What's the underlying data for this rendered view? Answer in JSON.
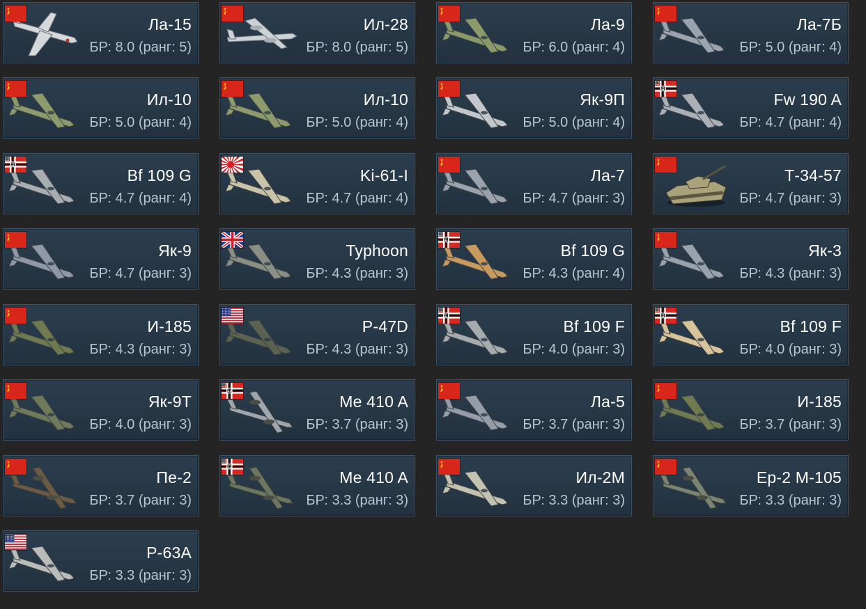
{
  "colors": {
    "background": "#242424",
    "card_bg": "#263746",
    "card_border": "#3c5466",
    "name_text": "#ffffff",
    "br_text": "#b8c6d0"
  },
  "vehicles": [
    {
      "name": "Ла-15",
      "br": "БР: 8.0 (ранг: 5)",
      "flag": "ussr",
      "kind": "jet",
      "camo": "#d6d9dc"
    },
    {
      "name": "Ил-28",
      "br": "БР: 8.0 (ранг: 5)",
      "flag": "ussr",
      "kind": "bomber",
      "camo": "#cdd2d6"
    },
    {
      "name": "Ла-9",
      "br": "БР: 6.0 (ранг: 4)",
      "flag": "ussr",
      "kind": "plane",
      "camo": "#8c9a6a"
    },
    {
      "name": "Ла-7Б",
      "br": "БР: 5.0 (ранг: 4)",
      "flag": "ussr",
      "kind": "plane",
      "camo": "#9aa4ae"
    },
    {
      "name": "Ил-10",
      "br": "БР: 5.0 (ранг: 4)",
      "flag": "ussr",
      "kind": "plane",
      "camo": "#8d9a6b"
    },
    {
      "name": "Ил-10",
      "br": "БР: 5.0 (ранг: 4)",
      "flag": "ussr",
      "kind": "plane",
      "camo": "#8d9a6b"
    },
    {
      "name": "Як-9П",
      "br": "БР: 5.0 (ранг: 4)",
      "flag": "ussr",
      "kind": "plane",
      "camo": "#c3c7cc"
    },
    {
      "name": "Fw 190 A",
      "br": "БР: 4.7 (ранг: 4)",
      "flag": "germany",
      "kind": "plane",
      "camo": "#aab0b6"
    },
    {
      "name": "Bf 109 G",
      "br": "БР: 4.7 (ранг: 4)",
      "flag": "germany",
      "kind": "plane",
      "camo": "#a8adb2"
    },
    {
      "name": "Ki-61-I",
      "br": "БР: 4.7 (ранг: 4)",
      "flag": "japan",
      "kind": "plane",
      "camo": "#c9c4a8"
    },
    {
      "name": "Ла-7",
      "br": "БР: 4.7 (ранг: 3)",
      "flag": "ussr",
      "kind": "plane",
      "camo": "#9aa3ab"
    },
    {
      "name": "Т-34-57",
      "br": "БР: 4.7 (ранг: 3)",
      "flag": "ussr",
      "kind": "tank",
      "camo": "#a9a27a"
    },
    {
      "name": "Як-9",
      "br": "БР: 4.7 (ранг: 3)",
      "flag": "ussr",
      "kind": "plane",
      "camo": "#8e98a6"
    },
    {
      "name": "Typhoon",
      "br": "БР: 4.3 (ранг: 3)",
      "flag": "uk",
      "kind": "plane",
      "camo": "#8a8f86"
    },
    {
      "name": "Bf 109 G",
      "br": "БР: 4.3 (ранг: 4)",
      "flag": "germany",
      "kind": "plane",
      "camo": "#c99a5e"
    },
    {
      "name": "Як-3",
      "br": "БР: 4.3 (ранг: 3)",
      "flag": "ussr",
      "kind": "plane",
      "camo": "#98a2ad"
    },
    {
      "name": "И-185",
      "br": "БР: 4.3 (ранг: 3)",
      "flag": "ussr",
      "kind": "plane",
      "camo": "#6f7a50"
    },
    {
      "name": "P-47D",
      "br": "БР: 4.3 (ранг: 3)",
      "flag": "usa",
      "kind": "plane",
      "camo": "#5c6250"
    },
    {
      "name": "Bf 109 F",
      "br": "БР: 4.0 (ранг: 3)",
      "flag": "germany",
      "kind": "plane",
      "camo": "#a6abae"
    },
    {
      "name": "Bf 109 F",
      "br": "БР: 4.0 (ранг: 3)",
      "flag": "germany",
      "kind": "plane",
      "camo": "#d8c49a"
    },
    {
      "name": "Як-9Т",
      "br": "БР: 4.0 (ранг: 3)",
      "flag": "ussr",
      "kind": "plane",
      "camo": "#6e7a5a"
    },
    {
      "name": "Me 410 A",
      "br": "БР: 3.7 (ранг: 3)",
      "flag": "germany",
      "kind": "twin",
      "camo": "#9fa6ae"
    },
    {
      "name": "Ла-5",
      "br": "БР: 3.7 (ранг: 3)",
      "flag": "ussr",
      "kind": "plane",
      "camo": "#959ea8"
    },
    {
      "name": "И-185",
      "br": "БР: 3.7 (ранг: 3)",
      "flag": "ussr",
      "kind": "plane",
      "camo": "#6f7a50"
    },
    {
      "name": "Пе-2",
      "br": "БР: 3.7 (ранг: 3)",
      "flag": "ussr",
      "kind": "twin",
      "camo": "#6a5a46"
    },
    {
      "name": "Me 410 A",
      "br": "БР: 3.3 (ранг: 3)",
      "flag": "germany",
      "kind": "twin",
      "camo": "#6d7760"
    },
    {
      "name": "Ил-2М",
      "br": "БР: 3.3 (ранг: 3)",
      "flag": "ussr",
      "kind": "plane",
      "camo": "#c4c2b0"
    },
    {
      "name": "Ер-2 М-105",
      "br": "БР: 3.3 (ранг: 3)",
      "flag": "ussr",
      "kind": "twin",
      "camo": "#7b8372"
    },
    {
      "name": "P-63A",
      "br": "БР: 3.3 (ранг: 3)",
      "flag": "usa",
      "kind": "plane",
      "camo": "#b9bcb8"
    }
  ]
}
